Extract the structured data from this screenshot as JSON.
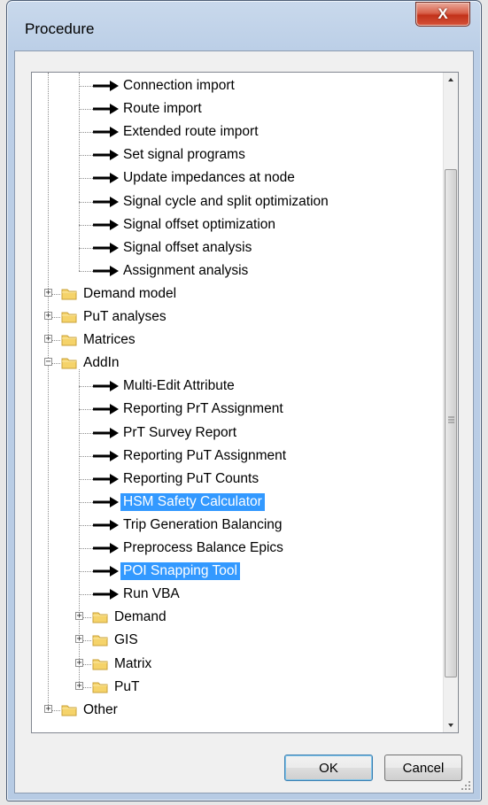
{
  "window": {
    "title": "Procedure",
    "close_label": "X"
  },
  "tree": {
    "items": [
      {
        "label": "Connection import",
        "kind": "procedure",
        "depth": 2
      },
      {
        "label": "Route import",
        "kind": "procedure",
        "depth": 2
      },
      {
        "label": "Extended route import",
        "kind": "procedure",
        "depth": 2
      },
      {
        "label": "Set signal programs",
        "kind": "procedure",
        "depth": 2
      },
      {
        "label": "Update impedances at node",
        "kind": "procedure",
        "depth": 2
      },
      {
        "label": "Signal cycle and split optimization",
        "kind": "procedure",
        "depth": 2
      },
      {
        "label": "Signal offset optimization",
        "kind": "procedure",
        "depth": 2
      },
      {
        "label": "Signal offset analysis",
        "kind": "procedure",
        "depth": 2
      },
      {
        "label": "Assignment analysis",
        "kind": "procedure",
        "depth": 2
      },
      {
        "label": "Demand model",
        "kind": "folder",
        "depth": 1,
        "expanded": false
      },
      {
        "label": "PuT analyses",
        "kind": "folder",
        "depth": 1,
        "expanded": false
      },
      {
        "label": "Matrices",
        "kind": "folder",
        "depth": 1,
        "expanded": false
      },
      {
        "label": "AddIn",
        "kind": "folder",
        "depth": 1,
        "expanded": true
      },
      {
        "label": "Multi-Edit Attribute",
        "kind": "procedure",
        "depth": 2
      },
      {
        "label": "Reporting PrT Assignment",
        "kind": "procedure",
        "depth": 2
      },
      {
        "label": "PrT Survey Report",
        "kind": "procedure",
        "depth": 2
      },
      {
        "label": "Reporting PuT Assignment",
        "kind": "procedure",
        "depth": 2
      },
      {
        "label": "Reporting PuT Counts",
        "kind": "procedure",
        "depth": 2
      },
      {
        "label": "HSM Safety Calculator",
        "kind": "procedure",
        "depth": 2,
        "selected": true
      },
      {
        "label": "Trip Generation Balancing",
        "kind": "procedure",
        "depth": 2
      },
      {
        "label": "Preprocess Balance Epics",
        "kind": "procedure",
        "depth": 2
      },
      {
        "label": "POI Snapping Tool",
        "kind": "procedure",
        "depth": 2,
        "selected": true
      },
      {
        "label": "Run VBA",
        "kind": "procedure",
        "depth": 2
      },
      {
        "label": "Demand",
        "kind": "folder",
        "depth": 2,
        "expanded": false
      },
      {
        "label": "GIS",
        "kind": "folder",
        "depth": 2,
        "expanded": false
      },
      {
        "label": "Matrix",
        "kind": "folder",
        "depth": 2,
        "expanded": false
      },
      {
        "label": "PuT",
        "kind": "folder",
        "depth": 2,
        "expanded": false
      },
      {
        "label": "Other",
        "kind": "folder",
        "depth": 1,
        "expanded": false
      }
    ]
  },
  "buttons": {
    "ok_label": "OK",
    "cancel_label": "Cancel"
  },
  "colors": {
    "selection": "#3399ff",
    "close_button": "#c9452b"
  }
}
